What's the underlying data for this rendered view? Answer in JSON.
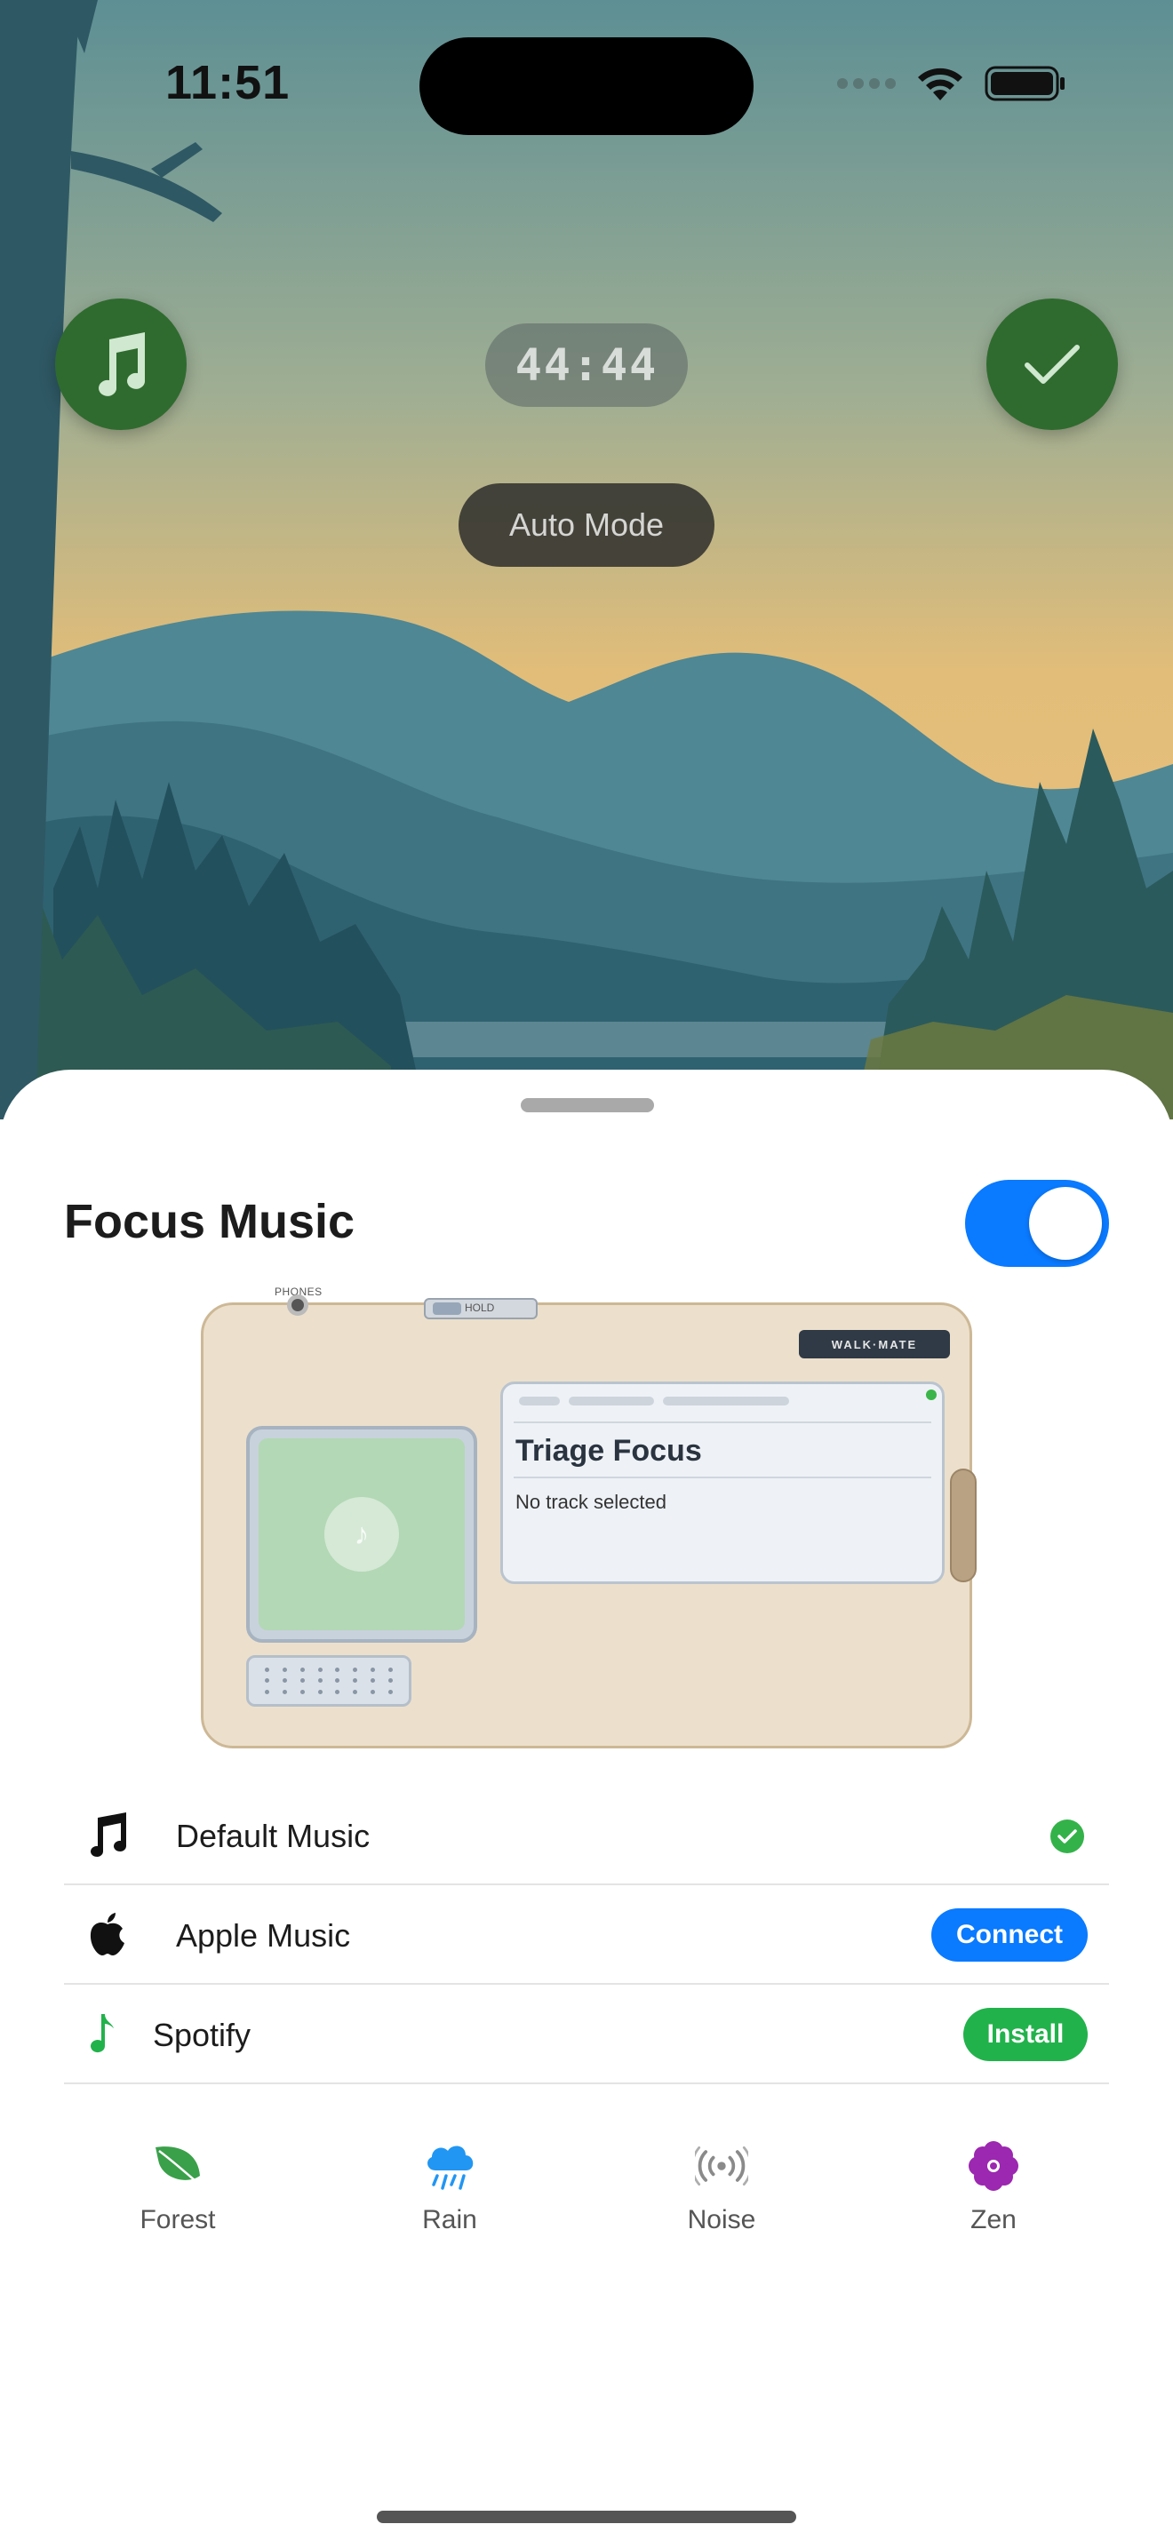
{
  "status_bar": {
    "time": "11:51"
  },
  "overlay": {
    "timer": "44:44",
    "mode": "Auto Mode",
    "accent": "#2f6b2f"
  },
  "sheet": {
    "title": "Focus Music",
    "toggle_on": true,
    "toggle_color": "#0a7aff"
  },
  "player": {
    "phones_label": "PHONES",
    "hold_label": "HOLD",
    "brand": "WALK·MATE",
    "track_title": "Triage Focus",
    "track_status": "No track selected"
  },
  "services": [
    {
      "label": "Default Music",
      "icon": "music-note-icon",
      "state": "selected"
    },
    {
      "label": "Apple Music",
      "icon": "apple-icon",
      "action": "Connect"
    },
    {
      "label": "Spotify",
      "icon": "spotify-note-icon",
      "action": "Install"
    }
  ],
  "sounds": [
    {
      "label": "Forest",
      "icon": "leaf-icon",
      "color": "#3aa04a"
    },
    {
      "label": "Rain",
      "icon": "rain-cloud-icon",
      "color": "#2196f3"
    },
    {
      "label": "Noise",
      "icon": "broadcast-icon",
      "color": "#8a8a8a"
    },
    {
      "label": "Zen",
      "icon": "flower-icon",
      "color": "#9c27b0"
    }
  ]
}
